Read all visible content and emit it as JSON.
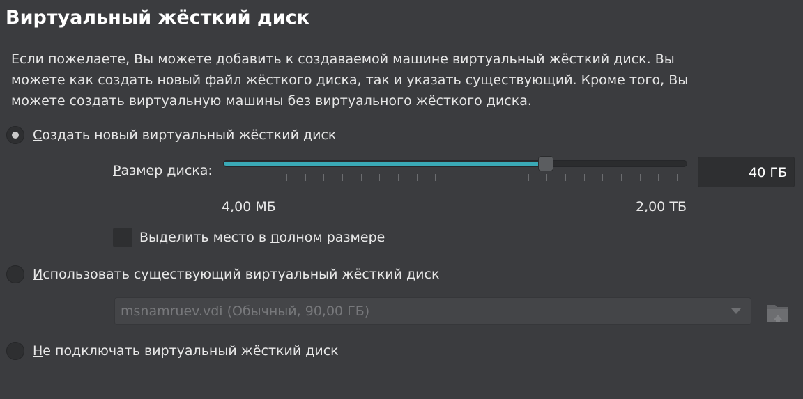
{
  "header": {
    "title": "Виртуальный жёсткий диск"
  },
  "description": {
    "lines": [
      "Если пожелаете, Вы можете добавить к создаваемой машине виртуальный жёсткий диск. Вы",
      "можете как создать новый файл жёсткого диска, так и указать существующий. Кроме того, Вы",
      "можете создать виртуальную машины без виртуального жёсткого диска."
    ]
  },
  "options": {
    "create_new": {
      "accel": "С",
      "rest": "оздать новый виртуальный жёсткий диск",
      "checked": true
    },
    "use_existing": {
      "accel": "И",
      "rest": "спользовать существующий виртуальный жёсткий диск",
      "checked": false
    },
    "no_disk": {
      "accel": "Н",
      "rest": "е подключать виртуальный жёсткий диск",
      "checked": false
    }
  },
  "disk_size": {
    "label_accel": "Р",
    "label_rest": "азмер диска:",
    "value": "40 ГБ",
    "min_label": "4,00 МБ",
    "max_label": "2,00 ТБ",
    "slider_fraction": 0.695,
    "tick_count": 25
  },
  "preallocate": {
    "label_before": "Выделить место в ",
    "label_accel": "п",
    "label_after": "олном размере",
    "checked": false
  },
  "existing_disk": {
    "selected": "msnamruev.vdi (Обычный, 90,00 ГБ)",
    "enabled": false
  },
  "icons": {
    "combo_arrow": "chevron-down-icon",
    "choose_file": "folder-icon"
  },
  "colors": {
    "accent": "#3aa9b6",
    "background": "#3b3c3f"
  }
}
